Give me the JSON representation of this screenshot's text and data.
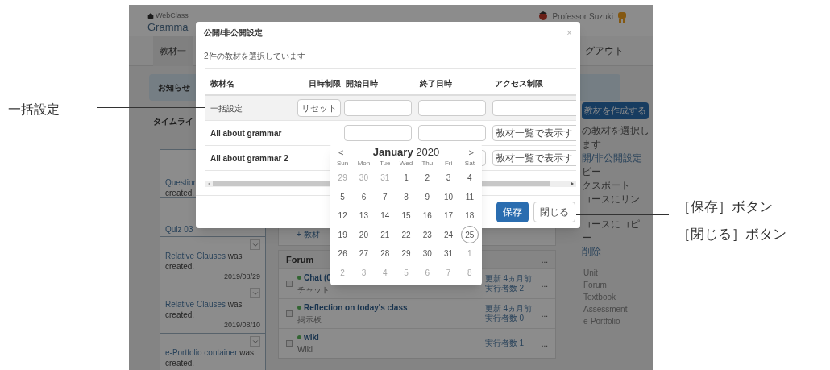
{
  "annotations": {
    "left": "一括設定",
    "right": [
      "［保存］ボタン",
      "［閉じる］ボタン"
    ]
  },
  "page": {
    "brand": "WebClass",
    "course": "Gramma",
    "user": "Professor Suzuki",
    "nav": [
      "教材一",
      "グアウト"
    ],
    "notice": "お知らせ",
    "timeline_title": "タイムライ",
    "timeline": [
      {
        "kind": "cut",
        "link": "Question",
        "text": "created.",
        "menu_button": false
      },
      {
        "link": "Quiz 03",
        "menu_button": false
      },
      {
        "link": "Relative Clauses",
        "text": "was created.",
        "date": "2019/08/29",
        "menu_button": true
      },
      {
        "link": "Relative Clauses",
        "text": "was created.",
        "date": "2019/08/10",
        "menu_button": true
      },
      {
        "link": "e-Portfolio container",
        "text": "was created.",
        "menu_button": true
      }
    ],
    "unit_add": "+ 教材",
    "forum": {
      "title": "Forum",
      "menu": "...",
      "rows": [
        {
          "title": "Chat (0",
          "type": "チャット",
          "updated": "更新 4ヵ月前",
          "count": "実行者数 2",
          "menu": "...",
          "checked": false
        },
        {
          "title": "Reflection on today's class",
          "type": "掲示板",
          "updated": "更新 4ヵ月前",
          "count": "実行者数 0",
          "menu": "...",
          "checked": false
        },
        {
          "title": "wiki",
          "type": "Wiki",
          "count": "実行者数 1",
          "menu": "...",
          "checked": false
        }
      ]
    },
    "side": {
      "create_button": "教材を作成する",
      "actions": [
        {
          "kind": "text",
          "text": "の教材を選択し"
        },
        {
          "kind": "text",
          "text": "ます"
        },
        {
          "kind": "link",
          "text": "開/非公開設定"
        },
        {
          "kind": "text",
          "text": "ピー"
        },
        {
          "kind": "text",
          "text": "クスポート"
        },
        {
          "kind": "text",
          "text": "コースにリン"
        },
        {
          "kind": "text",
          "text": "コースにコピ"
        },
        {
          "kind": "text",
          "text": "ー"
        },
        {
          "kind": "link",
          "text": "削除"
        }
      ],
      "categories": [
        "Unit",
        "Forum",
        "Textbook",
        "Assessment",
        "e-Portfolio"
      ]
    }
  },
  "dialog": {
    "title": "公開/非公開設定",
    "close": "×",
    "subtitle": "2件の教材を選択しています",
    "columns": [
      "教材名",
      "日時制限",
      "開始日時",
      "終了日時",
      "アクセス制限"
    ],
    "rows": [
      {
        "kind": "bulk",
        "name": "一括設定",
        "reset": "リセット",
        "start_field": true
      },
      {
        "kind": "item",
        "name": "All about grammar",
        "access": "教材一覧で表示す",
        "start_field": true
      },
      {
        "kind": "item",
        "name": "All about grammar 2",
        "access": "教材一覧で表示す",
        "start_field": false
      }
    ],
    "buttons": [
      {
        "label": "保存",
        "kind": "primary"
      },
      {
        "label": "閉じる",
        "kind": "default"
      }
    ]
  },
  "calendar": {
    "month": "January",
    "year": "2020",
    "prev": "<",
    "next": ">",
    "weekdays": [
      "Sun",
      "Mon",
      "Tue",
      "Wed",
      "Thu",
      "Fri",
      "Sat"
    ],
    "weeks": [
      [
        {
          "day": "29",
          "muted": true,
          "selected": false
        },
        {
          "day": "30",
          "muted": true,
          "selected": false
        },
        {
          "day": "31",
          "muted": true,
          "selected": false
        },
        {
          "day": "1",
          "muted": false,
          "selected": false
        },
        {
          "day": "2",
          "muted": false,
          "selected": false
        },
        {
          "day": "3",
          "muted": false,
          "selected": false
        },
        {
          "day": "4",
          "muted": false,
          "selected": false
        }
      ],
      [
        {
          "day": "5",
          "muted": false,
          "selected": false
        },
        {
          "day": "6",
          "muted": false,
          "selected": false
        },
        {
          "day": "7",
          "muted": false,
          "selected": false
        },
        {
          "day": "8",
          "muted": false,
          "selected": false
        },
        {
          "day": "9",
          "muted": false,
          "selected": false
        },
        {
          "day": "10",
          "muted": false,
          "selected": false
        },
        {
          "day": "11",
          "muted": false,
          "selected": false
        }
      ],
      [
        {
          "day": "12",
          "muted": false,
          "selected": false
        },
        {
          "day": "13",
          "muted": false,
          "selected": false
        },
        {
          "day": "14",
          "muted": false,
          "selected": false
        },
        {
          "day": "15",
          "muted": false,
          "selected": false
        },
        {
          "day": "16",
          "muted": false,
          "selected": false
        },
        {
          "day": "17",
          "muted": false,
          "selected": false
        },
        {
          "day": "18",
          "muted": false,
          "selected": false
        }
      ],
      [
        {
          "day": "19",
          "muted": false,
          "selected": false
        },
        {
          "day": "20",
          "muted": false,
          "selected": false
        },
        {
          "day": "21",
          "muted": false,
          "selected": false
        },
        {
          "day": "22",
          "muted": false,
          "selected": false
        },
        {
          "day": "23",
          "muted": false,
          "selected": false
        },
        {
          "day": "24",
          "muted": false,
          "selected": false
        },
        {
          "day": "25",
          "muted": false,
          "selected": true
        }
      ],
      [
        {
          "day": "26",
          "muted": false,
          "selected": false
        },
        {
          "day": "27",
          "muted": false,
          "selected": false
        },
        {
          "day": "28",
          "muted": false,
          "selected": false
        },
        {
          "day": "29",
          "muted": false,
          "selected": false
        },
        {
          "day": "30",
          "muted": false,
          "selected": false
        },
        {
          "day": "31",
          "muted": false,
          "selected": false
        },
        {
          "day": "1",
          "muted": true,
          "selected": false
        }
      ],
      [
        {
          "day": "2",
          "muted": true,
          "selected": false
        },
        {
          "day": "3",
          "muted": true,
          "selected": false
        },
        {
          "day": "4",
          "muted": true,
          "selected": false
        },
        {
          "day": "5",
          "muted": true,
          "selected": false
        },
        {
          "day": "6",
          "muted": true,
          "selected": false
        },
        {
          "day": "7",
          "muted": true,
          "selected": false
        },
        {
          "day": "8",
          "muted": true,
          "selected": false
        }
      ]
    ]
  }
}
